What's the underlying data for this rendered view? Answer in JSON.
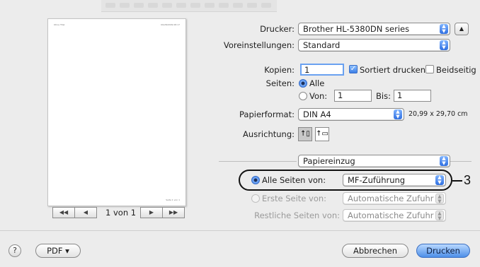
{
  "preview": {
    "header_left": "Ohne Titel",
    "header_right": "09/28/2009 08:17",
    "footer_right": "Seite 1 von 1",
    "pager_text": "1 von 1",
    "first_label": "◀◀",
    "prev_label": "◀",
    "next_label": "▶",
    "last_label": "▶▶"
  },
  "form": {
    "printer_label": "Drucker:",
    "printer_value": "Brother HL-5380DN series",
    "presets_label": "Voreinstellungen:",
    "presets_value": "Standard",
    "copies_label": "Kopien:",
    "copies_value": "1",
    "collate_label": "Sortiert drucken",
    "duplex_label": "Beidseitig",
    "pages_label": "Seiten:",
    "pages_all": "Alle",
    "pages_from": "Von:",
    "pages_from_value": "1",
    "pages_to": "Bis:",
    "pages_to_value": "1",
    "paper_label": "Papierformat:",
    "paper_value": "DIN A4",
    "paper_size": "20,99 x 29,70 cm",
    "orientation_label": "Ausrichtung:",
    "section_value": "Papiereinzug",
    "all_pages_from": "Alle Seiten von:",
    "all_pages_value": "MF-Zuführung",
    "first_page_from": "Erste Seite von:",
    "first_page_value": "Automatische Zufuhr",
    "remaining_from": "Restliche Seiten von:",
    "remaining_value": "Automatische Zufuhr",
    "callout": "3"
  },
  "footer": {
    "help_label": "?",
    "pdf_label": "PDF ▾",
    "cancel_label": "Abbrechen",
    "print_label": "Drucken"
  },
  "icons": [
    "expand-icon",
    "portrait-orientation-icon",
    "landscape-orientation-icon",
    "help-icon",
    "popup-arrows-icon"
  ]
}
